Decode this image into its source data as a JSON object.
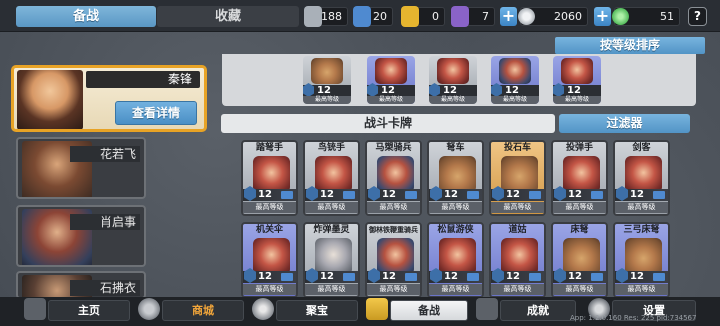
{
  "tabs": {
    "active": "备战",
    "inactive": "收藏"
  },
  "resources": [
    {
      "icon": "silver-medal-icon",
      "value": "188",
      "color": "#a9b0b8"
    },
    {
      "icon": "blue-banner-icon",
      "value": "20",
      "color": "#4f8ad0"
    },
    {
      "icon": "gold-banner-icon",
      "value": "0",
      "color": "#e6b52f"
    },
    {
      "icon": "purple-banner-icon",
      "value": "7",
      "color": "#8a63c8"
    }
  ],
  "currency": [
    {
      "icon": "silver-coin-icon",
      "value": "2060"
    },
    {
      "icon": "jade-icon",
      "value": "51"
    }
  ],
  "help_label": "?",
  "hero": {
    "name": "秦锋",
    "detail_label": "查看详情"
  },
  "other_heroes": [
    "花若飞",
    "肖启事",
    "石拂衣"
  ],
  "sort_label": "按等级排序",
  "deck_title": "战斗卡牌",
  "filter_label": "过滤器",
  "max_label": "最高等级",
  "level": "12",
  "top_units": [
    "u1",
    "u2",
    "u3",
    "u4",
    "u5"
  ],
  "cards_row1": [
    {
      "name": "踏弩手",
      "rarity": "common",
      "art": "a-red"
    },
    {
      "name": "鸟铳手",
      "rarity": "common",
      "art": "a-red"
    },
    {
      "name": "马槊骑兵",
      "rarity": "common",
      "art": "a-blue"
    },
    {
      "name": "弩车",
      "rarity": "common",
      "art": "a-wood"
    },
    {
      "name": "投石车",
      "rarity": "epic",
      "art": "a-wood"
    },
    {
      "name": "投弹手",
      "rarity": "common",
      "art": "a-red"
    },
    {
      "name": "剑客",
      "rarity": "common",
      "art": "a-red"
    }
  ],
  "cards_row2": [
    {
      "name": "机关伞",
      "rarity": "rare",
      "art": "a-red"
    },
    {
      "name": "炸弹墨灵",
      "rarity": "common",
      "art": "a-gray"
    },
    {
      "name": "御林铁鞭重骑兵",
      "rarity": "common",
      "art": "a-blue"
    },
    {
      "name": "松鼠游侠",
      "rarity": "rare",
      "art": "a-red"
    },
    {
      "name": "道姑",
      "rarity": "rare",
      "art": "a-red"
    },
    {
      "name": "床弩",
      "rarity": "rare",
      "art": "a-wood"
    },
    {
      "name": "三弓床弩",
      "rarity": "rare",
      "art": "a-wood"
    }
  ],
  "nav": [
    {
      "label": "主页",
      "icon": "home-icon"
    },
    {
      "label": "商城",
      "icon": "shop-icon"
    },
    {
      "label": "聚宝",
      "icon": "treasure-icon"
    },
    {
      "label": "备战",
      "icon": "cards-icon"
    },
    {
      "label": "成就",
      "icon": "achievement-icon"
    },
    {
      "label": "设置",
      "icon": "gear-icon"
    }
  ],
  "version": "App: 1.2.0.160 Res: 225 pid:734567"
}
